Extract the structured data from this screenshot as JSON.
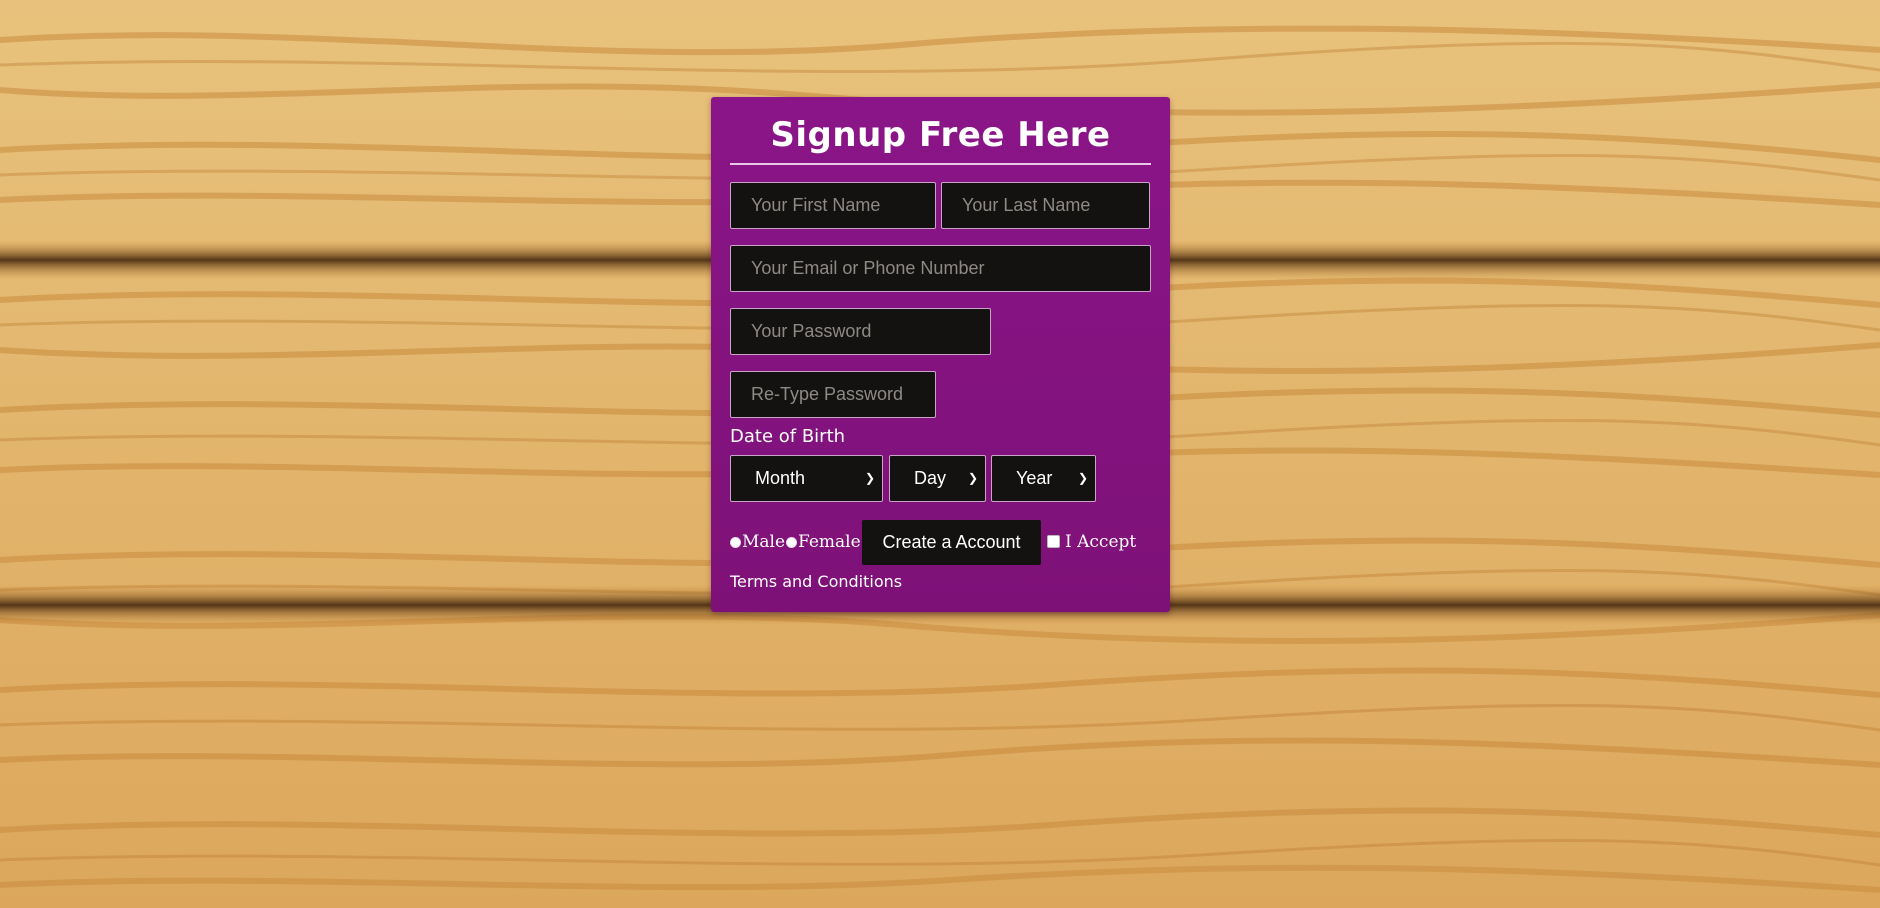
{
  "colors": {
    "card_background": "#861485",
    "field_background": "#141210",
    "field_border": "#c9a4c6",
    "wood_light": "#e8c27c",
    "wood_grain": "#c98a3c"
  },
  "form": {
    "title": "Signup Free Here",
    "first_name_placeholder": "Your First Name",
    "last_name_placeholder": "Your Last Name",
    "email_placeholder": "Your Email or Phone Number",
    "password_placeholder": "Your Password",
    "retype_password_placeholder": "Re-Type Password",
    "dob_label": "Date of Birth",
    "month_selected": "Month",
    "day_selected": "Day",
    "year_selected": "Year",
    "gender_male": "Male",
    "gender_female": "Female",
    "submit_label": "Create a Account",
    "accept_label": "I Accept",
    "terms_label": "Terms and Conditions"
  },
  "icons": {
    "dropdown": "chevron-down-icon"
  }
}
